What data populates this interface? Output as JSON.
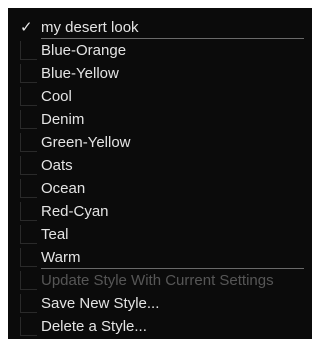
{
  "menu": {
    "current_style": {
      "label": "my desert look",
      "check_glyph": "✓"
    },
    "styles": [
      {
        "label": "Blue-Orange"
      },
      {
        "label": "Blue-Yellow"
      },
      {
        "label": "Cool"
      },
      {
        "label": "Denim"
      },
      {
        "label": "Green-Yellow"
      },
      {
        "label": "Oats"
      },
      {
        "label": "Ocean"
      },
      {
        "label": "Red-Cyan"
      },
      {
        "label": "Teal"
      },
      {
        "label": "Warm"
      }
    ],
    "actions": {
      "update_label": "Update Style With Current Settings",
      "save_label": "Save New Style...",
      "delete_label": "Delete a Style..."
    }
  },
  "colors": {
    "background": "#0b0b0b",
    "text": "#e4e4e4",
    "disabled_text": "#565656"
  }
}
